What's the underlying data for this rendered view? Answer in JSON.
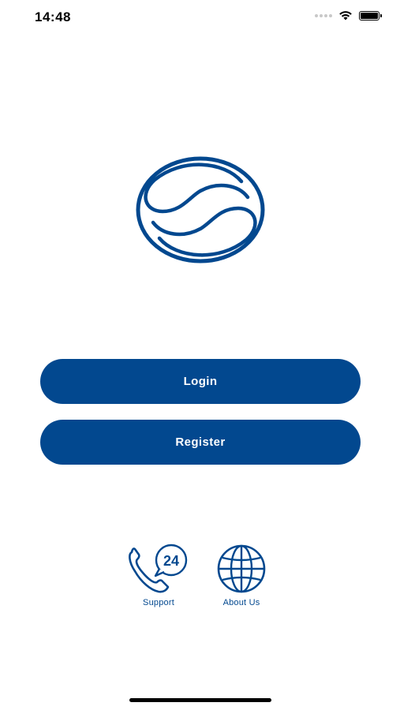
{
  "status_bar": {
    "time": "14:48"
  },
  "colors": {
    "primary": "#02488f",
    "background": "#ffffff"
  },
  "buttons": {
    "login_label": "Login",
    "register_label": "Register"
  },
  "links": {
    "support_label": "Support",
    "about_label": "About Us"
  },
  "icons": {
    "logo": "brand-logo",
    "support": "phone-24-icon",
    "about": "globe-icon"
  }
}
